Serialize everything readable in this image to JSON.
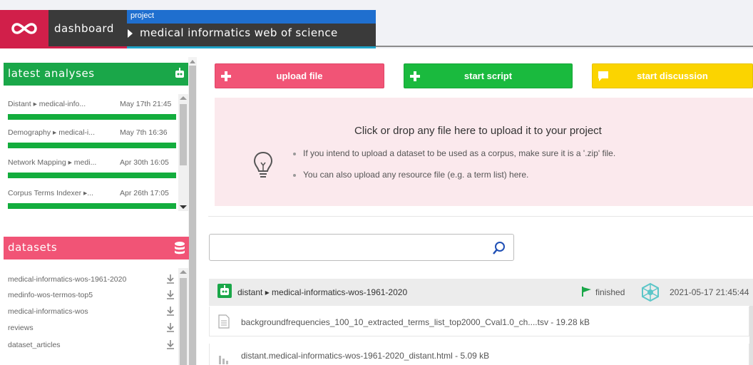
{
  "header": {
    "dashboard_label": "dashboard",
    "project_caption": "project",
    "project_name": "medical informatics web of science"
  },
  "latest_analyses": {
    "title": "latest analyses",
    "items": [
      {
        "name": "Distant ▸ medical-info...",
        "date": "May 17th 21:45"
      },
      {
        "name": "Demography ▸ medical-i...",
        "date": "May 7th 16:36"
      },
      {
        "name": "Network Mapping ▸ medi...",
        "date": "Apr 30th 16:05"
      },
      {
        "name": "Corpus Terms Indexer ▸...",
        "date": "Apr 26th 17:05"
      }
    ]
  },
  "datasets": {
    "title": "datasets",
    "items": [
      {
        "name": "medical-informatics-wos-1961-2020"
      },
      {
        "name": "medinfo-wos-termos-top5"
      },
      {
        "name": "medical-informatics-wos"
      },
      {
        "name": "reviews"
      },
      {
        "name": "dataset_articles"
      }
    ]
  },
  "actions": {
    "upload": "upload file",
    "script": "start script",
    "discussion": "start discussion"
  },
  "dropzone": {
    "title": "Click or drop any file here to upload it to your project",
    "bullets": [
      "If you intend to upload a dataset to be used as a corpus, make sure it is a '.zip' file.",
      "You can also upload any resource file (e.g. a term list) here."
    ]
  },
  "search": {
    "placeholder": "",
    "value": ""
  },
  "result": {
    "title": "distant ▸ medical-informatics-wos-1961-2020",
    "status": "finished",
    "date": "2021-05-17 21:45:44",
    "files": [
      {
        "text": "backgroundfrequencies_100_10_extracted_terms_list_top2000_Cval1.0_ch....tsv - 19.28 kB"
      },
      {
        "text": "distant.medical-informatics-wos-1961-2020_distant.html - 5.09 kB"
      }
    ]
  },
  "colors": {
    "brand_red": "#d11f4a",
    "project_blue": "#1f6fcf",
    "green": "#1aa749",
    "pink": "#f15476",
    "yellow": "#fbd400"
  },
  "icons": {
    "logo": "infinity-logo-icon",
    "robot": "robot-icon",
    "database": "database-icon",
    "plus": "plus-icon",
    "chat": "chat-icon",
    "lightbulb": "lightbulb-icon",
    "search": "search-icon",
    "download": "download-icon",
    "flag": "flag-icon",
    "file": "file-icon",
    "chart": "bar-chart-file-icon"
  }
}
